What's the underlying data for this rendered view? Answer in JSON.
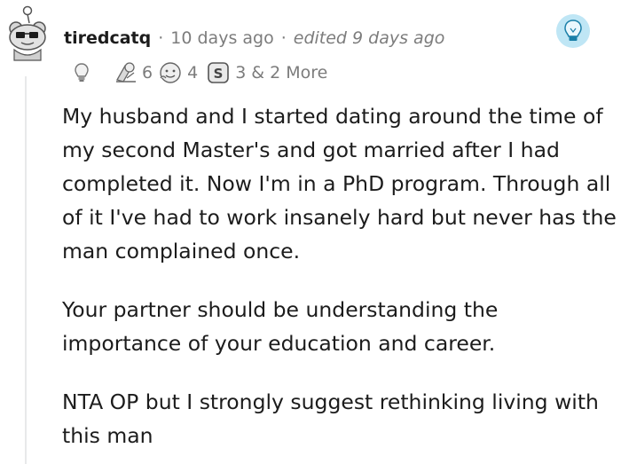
{
  "comment": {
    "author": "tiredcatq",
    "separator": "·",
    "time_ago": "10 days ago",
    "edited": "edited 9 days ago",
    "avatar_icon": "snoo-sunglasses-avatar-icon",
    "flair_icon": "lightbulb-badge-icon",
    "awards": [
      {
        "icon": "lightbulb-award-icon",
        "count": ""
      },
      {
        "icon": "helpful-award-icon",
        "count": "6"
      },
      {
        "icon": "wholesome-award-icon",
        "count": "4"
      },
      {
        "icon": "silver-award-icon",
        "count": "3"
      }
    ],
    "more_awards": "& 2 More",
    "paragraphs": [
      "My husband and I started dating around the time of my second Master's and got married after I had completed it. Now I'm in a PhD program. Through all of it I've had to work insanely hard but never has the man complained once.",
      "Your partner should be understanding the importance of your education and career.",
      "NTA OP but I strongly suggest rethinking living with this man"
    ]
  }
}
